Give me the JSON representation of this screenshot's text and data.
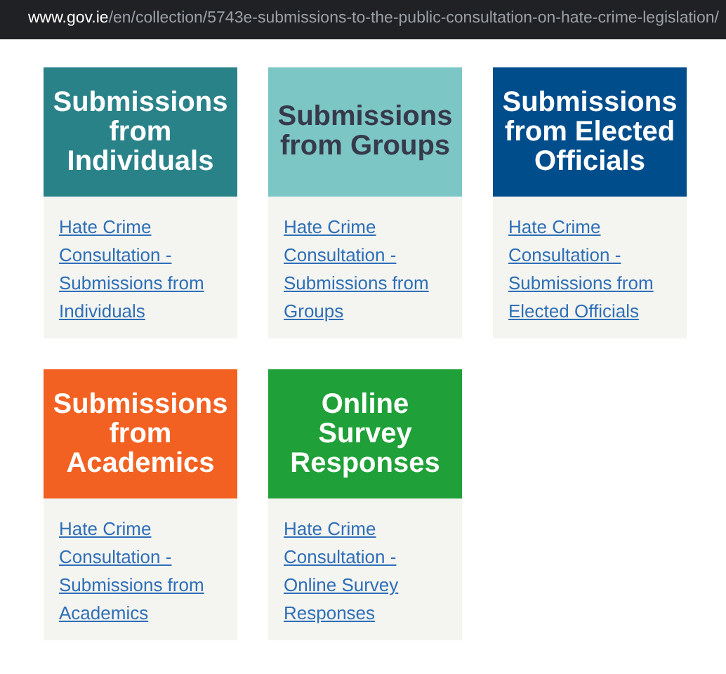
{
  "address_bar": {
    "domain": "www.gov.ie",
    "path": "/en/collection/5743e-submissions-to-the-public-consultation-on-hate-crime-legislation/"
  },
  "cards": [
    {
      "title": "Submissions from Individuals",
      "color": "#2a8289",
      "dark_title": false,
      "link": "Hate Crime Consultation - Submissions from Individuals"
    },
    {
      "title": "Submissions from Groups",
      "color": "#7cc6c6",
      "dark_title": true,
      "link": "Hate Crime Consultation - Submissions from Groups"
    },
    {
      "title": "Submissions from Elected Officials",
      "color": "#004d8c",
      "dark_title": false,
      "link": "Hate Crime Consultation - Submissions from Elected Officials"
    },
    {
      "title": "Submissions from Academics",
      "color": "#f26122",
      "dark_title": false,
      "link": "Hate Crime Consultation - Submissions from Academics"
    },
    {
      "title": "Online Survey Responses",
      "color": "#1fa038",
      "dark_title": false,
      "link": "Hate Crime Consultation - Online Survey Responses"
    }
  ]
}
